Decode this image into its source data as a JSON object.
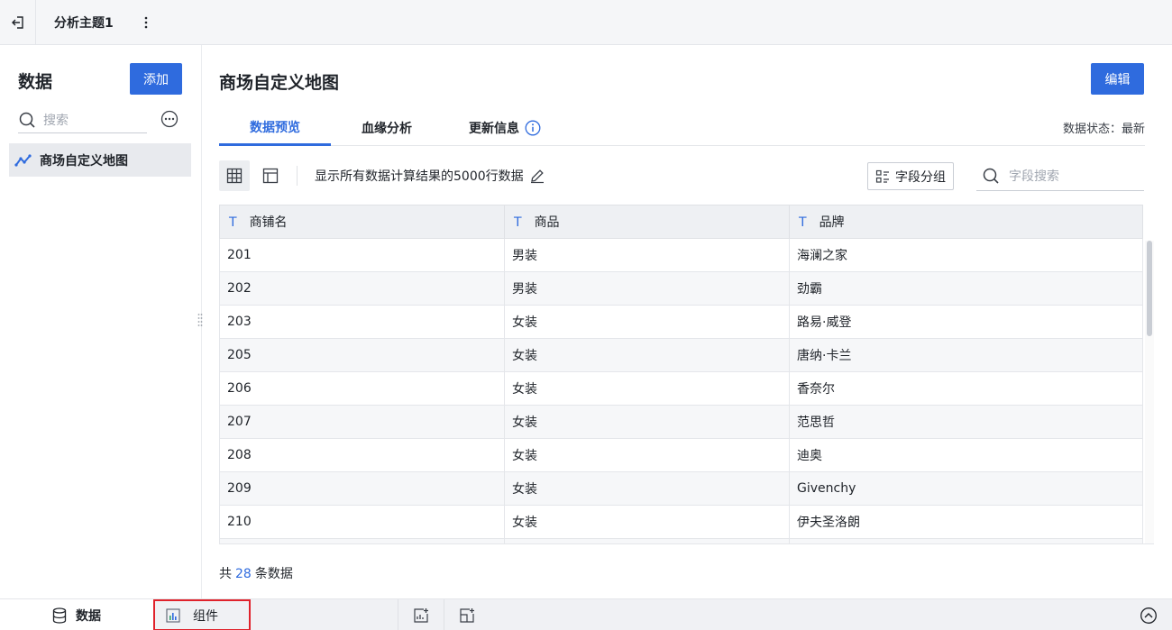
{
  "topbar": {
    "tab_title": "分析主题1"
  },
  "left": {
    "heading": "数据",
    "add_label": "添加",
    "search_placeholder": "搜索",
    "dataset_name": "商场自定义地图"
  },
  "main": {
    "title": "商场自定义地图",
    "edit_label": "编辑",
    "tabs": [
      {
        "label": "数据预览"
      },
      {
        "label": "血缘分析"
      },
      {
        "label": "更新信息"
      }
    ],
    "status": "数据状态：最新",
    "toolbar": {
      "description": "显示所有数据计算结果的5000行数据",
      "group_label": "字段分组",
      "field_search_placeholder": "字段搜索"
    },
    "table": {
      "type_glyph": "T",
      "columns": [
        "商铺名",
        "商品",
        "品牌"
      ],
      "rows": [
        [
          "201",
          "男装",
          "海澜之家"
        ],
        [
          "202",
          "男装",
          "劲霸"
        ],
        [
          "203",
          "女装",
          "路易·威登"
        ],
        [
          "205",
          "女装",
          "唐纳·卡兰"
        ],
        [
          "206",
          "女装",
          "香奈尔"
        ],
        [
          "207",
          "女装",
          "范思哲"
        ],
        [
          "208",
          "女装",
          "迪奥"
        ],
        [
          "209",
          "女装",
          "Givenchy"
        ],
        [
          "210",
          "女装",
          "伊夫圣洛朗"
        ],
        [
          "",
          "",
          ""
        ]
      ]
    },
    "total": {
      "prefix": "共",
      "count": "28",
      "suffix": "条数据"
    }
  },
  "bottombar": {
    "data_label": "数据",
    "component_label": "组件"
  },
  "colors": {
    "accent": "#2f6bde",
    "highlight_border": "#e0222b"
  }
}
